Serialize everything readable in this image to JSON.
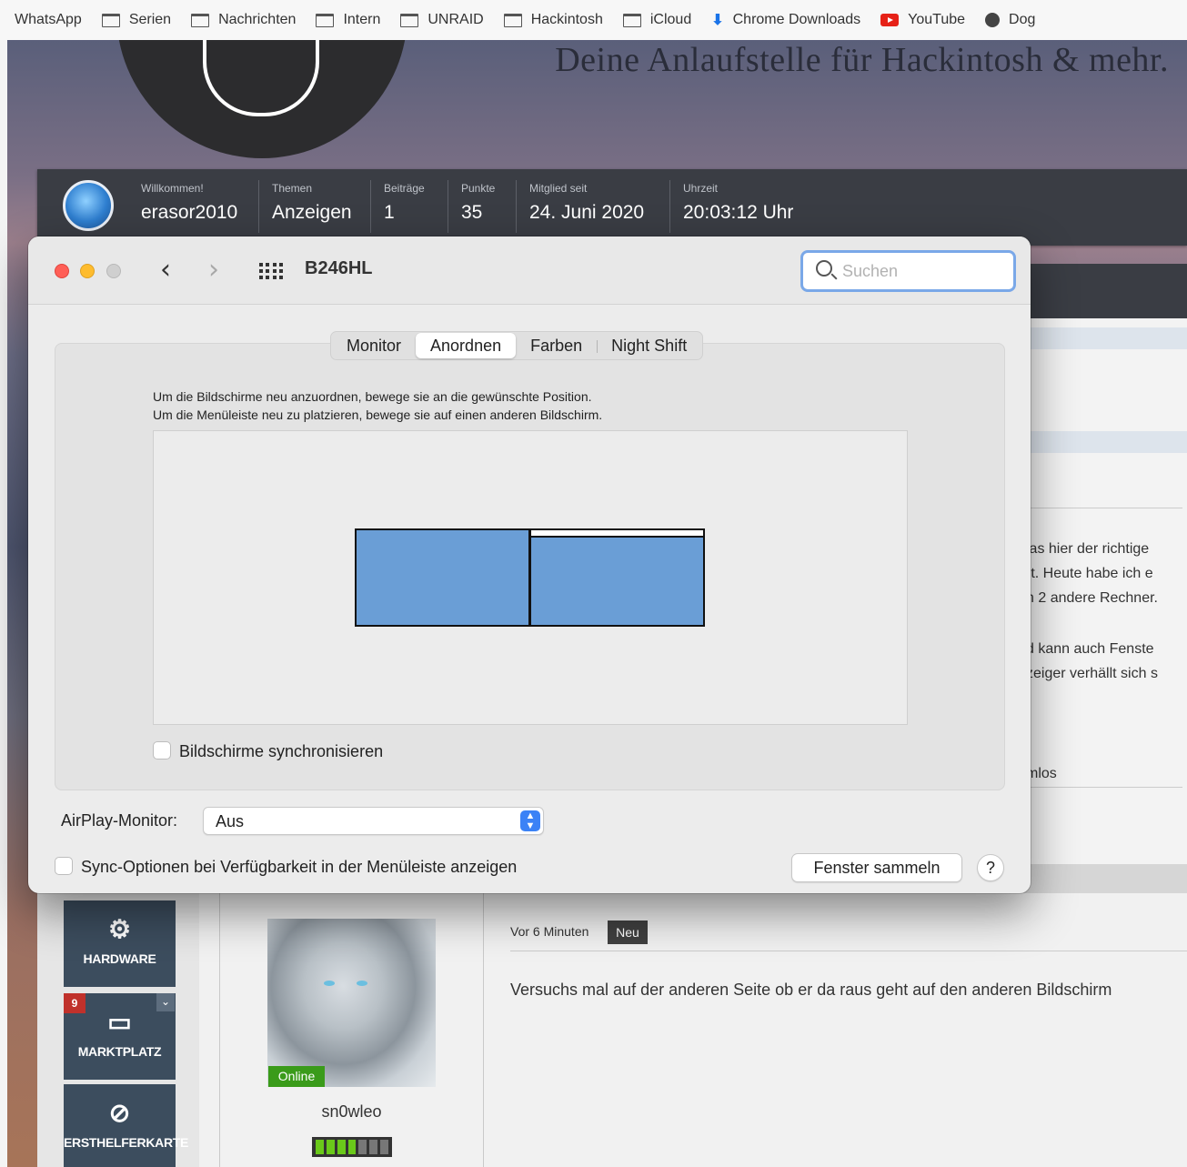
{
  "bookmarks": [
    {
      "label": "WhatsApp",
      "icon": "none"
    },
    {
      "label": "Serien",
      "icon": "folder-icon"
    },
    {
      "label": "Nachrichten",
      "icon": "folder-icon"
    },
    {
      "label": "Intern",
      "icon": "folder-icon"
    },
    {
      "label": "UNRAID",
      "icon": "folder-icon"
    },
    {
      "label": "Hackintosh",
      "icon": "folder-icon"
    },
    {
      "label": "iCloud",
      "icon": "folder-icon"
    },
    {
      "label": "Chrome Downloads",
      "icon": "download-icon"
    },
    {
      "label": "YouTube",
      "icon": "youtube-icon"
    },
    {
      "label": "Dog",
      "icon": "globe-icon"
    }
  ],
  "site": {
    "tagline": "Deine Anlaufstelle für Hackintosh & mehr.",
    "userbar": {
      "welcome_label": "Willkommen!",
      "username": "erasor2010",
      "topics_label": "Themen",
      "topics_value": "Anzeigen",
      "posts_label": "Beiträge",
      "posts_value": "1",
      "points_label": "Punkte",
      "points_value": "35",
      "member_since_label": "Mitglied seit",
      "member_since_value": "24. Juni 2020",
      "time_label": "Uhrzeit",
      "time_value": "20:03:12 Uhr"
    },
    "partial_text": [
      "las hier der richtige",
      "rt. Heute habe ich e",
      "n 2 andere Rechner.",
      "d kann auch Fenste",
      "zeiger verhällt sich s",
      "mlos"
    ],
    "sidebar": [
      {
        "label": "HARDWARE",
        "icon": "gears-icon"
      },
      {
        "label": "MARKTPLATZ",
        "icon": "card-icon",
        "badge": "9"
      },
      {
        "label": "ERSTHELFERKARTE",
        "icon": "compass-icon"
      }
    ],
    "post": {
      "online_label": "Online",
      "username": "sn0wleo",
      "rank_fraction": 0.57,
      "time": "Vor 6 Minuten",
      "new_badge": "Neu",
      "text": "Versuchs mal auf der anderen Seite ob er da raus geht auf den anderen Bildschirm"
    }
  },
  "prefs": {
    "title": "B246HL",
    "search_placeholder": "Suchen",
    "tabs": [
      {
        "label": "Monitor",
        "active": false
      },
      {
        "label": "Anordnen",
        "active": true
      },
      {
        "label": "Farben",
        "active": false
      },
      {
        "label": "Night Shift",
        "active": false
      }
    ],
    "instructions_line1": "Um die Bildschirme neu anzuordnen, bewege sie an die gewünschte Position.",
    "instructions_line2": "Um die Menüleiste neu zu platzieren, bewege sie auf einen anderen Bildschirm.",
    "mirror_label": "Bildschirme synchronisieren",
    "airplay_label": "AirPlay-Monitor:",
    "airplay_value": "Aus",
    "sync_options_label": "Sync-Optionen bei Verfügbarkeit in der Menüleiste anzeigen",
    "gather_windows_label": "Fenster sammeln",
    "help_label": "?"
  }
}
